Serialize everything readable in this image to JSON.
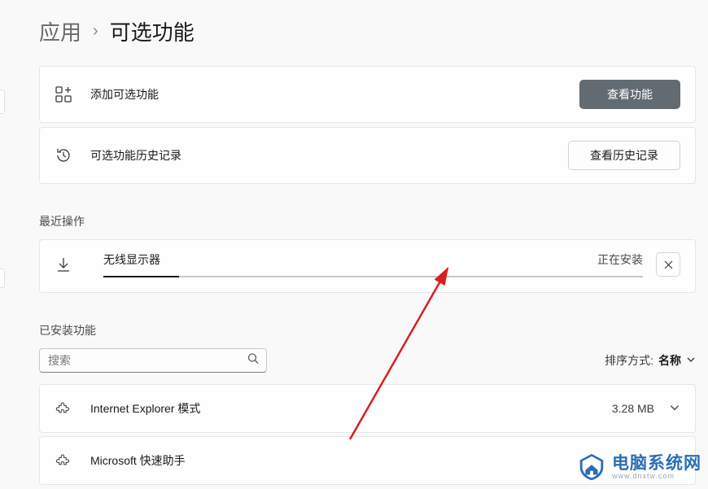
{
  "breadcrumb": {
    "parent": "应用",
    "current": "可选功能"
  },
  "addFeature": {
    "label": "添加可选功能",
    "button": "查看功能"
  },
  "history": {
    "label": "可选功能历史记录",
    "button": "查看历史记录"
  },
  "recent": {
    "title": "最近操作",
    "item": {
      "name": "无线显示器",
      "status": "正在安装",
      "progressPercent": 14
    }
  },
  "installed": {
    "title": "已安装功能",
    "searchPlaceholder": "搜索",
    "sort": {
      "label": "排序方式:",
      "value": "名称"
    },
    "items": [
      {
        "name": "Internet Explorer 模式",
        "size": "3.28 MB"
      },
      {
        "name": "Microsoft 快速助手",
        "size": ""
      }
    ]
  },
  "watermark": {
    "title": "电脑系统网",
    "sub": "www.dnxtw.com"
  }
}
